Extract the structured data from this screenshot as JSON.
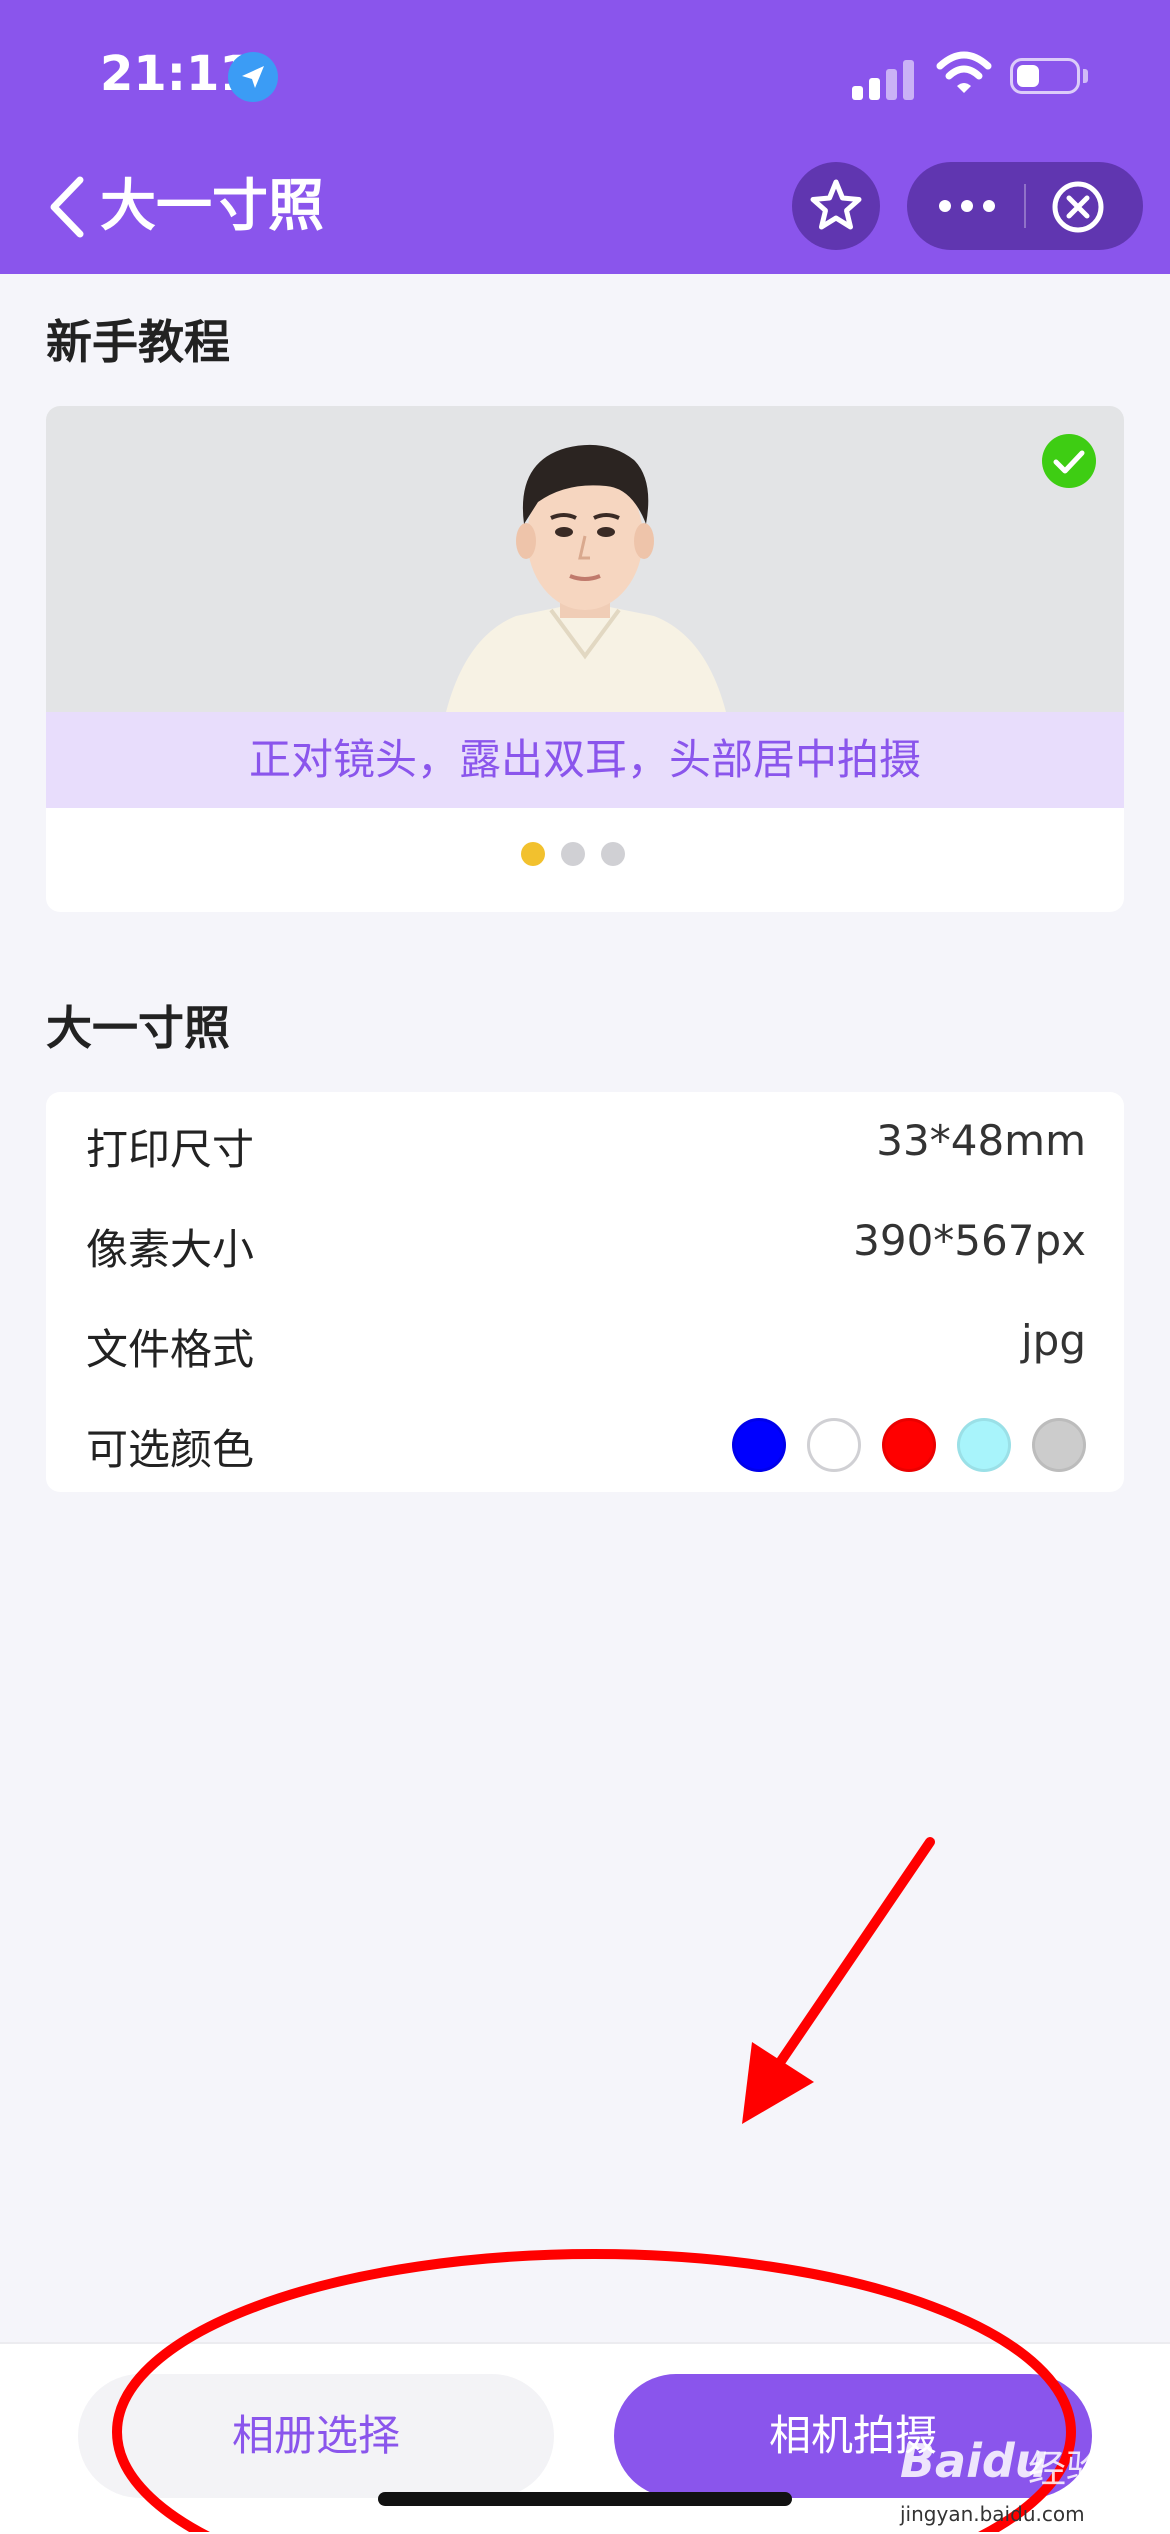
{
  "status_bar": {
    "time": "21:11"
  },
  "nav": {
    "title": "大一寸照"
  },
  "tutorial": {
    "section_title": "新手教程",
    "caption": "正对镜头，露出双耳，头部居中拍摄",
    "dots_count": 3,
    "active_dot": 0
  },
  "spec": {
    "section_title": "大一寸照",
    "rows": [
      {
        "label": "打印尺寸",
        "value": "33*48mm"
      },
      {
        "label": "像素大小",
        "value": "390*567px"
      },
      {
        "label": "文件格式",
        "value": "jpg"
      },
      {
        "label": "可选颜色"
      }
    ],
    "colors": [
      "#0000ff",
      "#ffffff",
      "#ff0000",
      "#a8f4fb",
      "#cccccc"
    ]
  },
  "actions": {
    "album_label": "相册选择",
    "camera_label": "相机拍摄"
  },
  "watermark": {
    "logo": "Baidu",
    "cn": "经验",
    "url": "jingyan.baidu.com"
  },
  "theme": {
    "primary": "#8a55ec",
    "dark": "#6036b0",
    "annotation": "#ff0000"
  }
}
